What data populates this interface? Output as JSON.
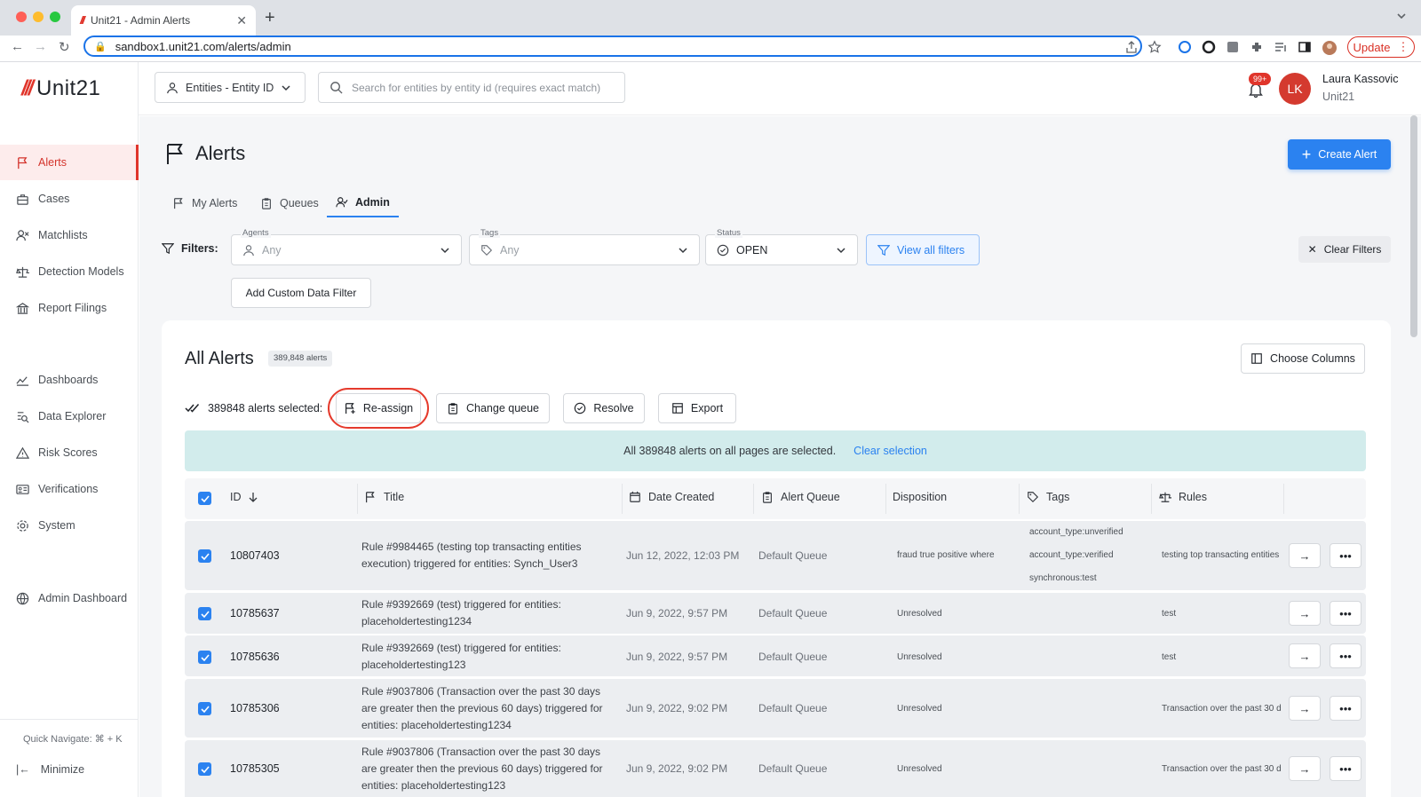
{
  "browser": {
    "tab_title": "Unit21 - Admin Alerts",
    "url": "sandbox1.unit21.com/alerts/admin",
    "update_label": "Update"
  },
  "sidebar": {
    "logo_text": "Unit21",
    "items": [
      {
        "label": "Alerts",
        "icon": "flag-icon",
        "active": true
      },
      {
        "label": "Cases",
        "icon": "briefcase-icon"
      },
      {
        "label": "Matchlists",
        "icon": "user-x-icon"
      },
      {
        "label": "Detection Models",
        "icon": "scale-icon"
      },
      {
        "label": "Report Filings",
        "icon": "bank-icon"
      },
      {
        "label": "Dashboards",
        "icon": "chart-icon"
      },
      {
        "label": "Data Explorer",
        "icon": "explore-icon"
      },
      {
        "label": "Risk Scores",
        "icon": "warning-icon"
      },
      {
        "label": "Verifications",
        "icon": "id-card-icon"
      },
      {
        "label": "System",
        "icon": "gear-icon"
      },
      {
        "label": "Admin Dashboard",
        "icon": "globe-icon"
      }
    ],
    "quick_navigate": "Quick Navigate: ⌘ + K",
    "minimize_label": "Minimize"
  },
  "header": {
    "entity_select": "Entities - Entity ID",
    "search_placeholder": "Search for entities by entity id (requires exact match)",
    "notifications_badge": "99+",
    "avatar_initials": "LK",
    "user_name": "Laura Kassovic",
    "user_org": "Unit21"
  },
  "page": {
    "title": "Alerts",
    "create_button": "Create Alert",
    "tabs": [
      {
        "label": "My Alerts",
        "active": false
      },
      {
        "label": "Queues",
        "active": false
      },
      {
        "label": "Admin",
        "active": true
      }
    ],
    "filters_label": "Filters:",
    "filters": {
      "agents": {
        "label": "Agents",
        "value": "Any"
      },
      "tags": {
        "label": "Tags",
        "value": "Any"
      },
      "status": {
        "label": "Status",
        "value": "OPEN"
      }
    },
    "view_all_filters": "View all filters",
    "clear_filters": "Clear Filters",
    "add_custom_filter": "Add Custom Data Filter"
  },
  "alerts_card": {
    "title": "All Alerts",
    "count_chip": "389,848 alerts",
    "choose_columns": "Choose Columns",
    "selected_text": "389848 alerts selected:",
    "actions": {
      "reassign": "Re-assign",
      "change_queue": "Change queue",
      "resolve": "Resolve",
      "export": "Export"
    },
    "banner_text": "All 389848 alerts on all pages are selected.",
    "banner_link": "Clear selection",
    "columns": {
      "id": "ID",
      "title": "Title",
      "date_created": "Date Created",
      "alert_queue": "Alert Queue",
      "disposition": "Disposition",
      "tags": "Tags",
      "rules": "Rules"
    },
    "rows": [
      {
        "id": "10807403",
        "title": "Rule #9984465 (testing top transacting entities execution) triggered for entities: Synch_User3",
        "date": "Jun 12, 2022, 12:03 PM",
        "queue": "Default Queue",
        "disposition": "fraud true positive where",
        "tags": [
          "account_type:unverified",
          "account_type:verified",
          "synchronous:test"
        ],
        "rules": "testing top transacting entities"
      },
      {
        "id": "10785637",
        "title": "Rule #9392669 (test) triggered for entities: placeholdertesting1234",
        "date": "Jun 9, 2022, 9:57 PM",
        "queue": "Default Queue",
        "disposition": "Unresolved",
        "tags": [],
        "rules": "test"
      },
      {
        "id": "10785636",
        "title": "Rule #9392669 (test) triggered for entities: placeholdertesting123",
        "date": "Jun 9, 2022, 9:57 PM",
        "queue": "Default Queue",
        "disposition": "Unresolved",
        "tags": [],
        "rules": "test"
      },
      {
        "id": "10785306",
        "title": "Rule #9037806 (Transaction over the past 30 days are greater then the previous 60 days) triggered for entities: placeholdertesting1234",
        "date": "Jun 9, 2022, 9:02 PM",
        "queue": "Default Queue",
        "disposition": "Unresolved",
        "tags": [],
        "rules": "Transaction over the past 30 d"
      },
      {
        "id": "10785305",
        "title": "Rule #9037806 (Transaction over the past 30 days are greater then the previous 60 days) triggered for entities: placeholdertesting123",
        "date": "Jun 9, 2022, 9:02 PM",
        "queue": "Default Queue",
        "disposition": "Unresolved",
        "tags": [],
        "rules": "Transaction over the past 30 d"
      }
    ]
  },
  "colors": {
    "brand": "#e0352b",
    "primary": "#2b82f0",
    "highlight_ring": "#e53a2c"
  }
}
